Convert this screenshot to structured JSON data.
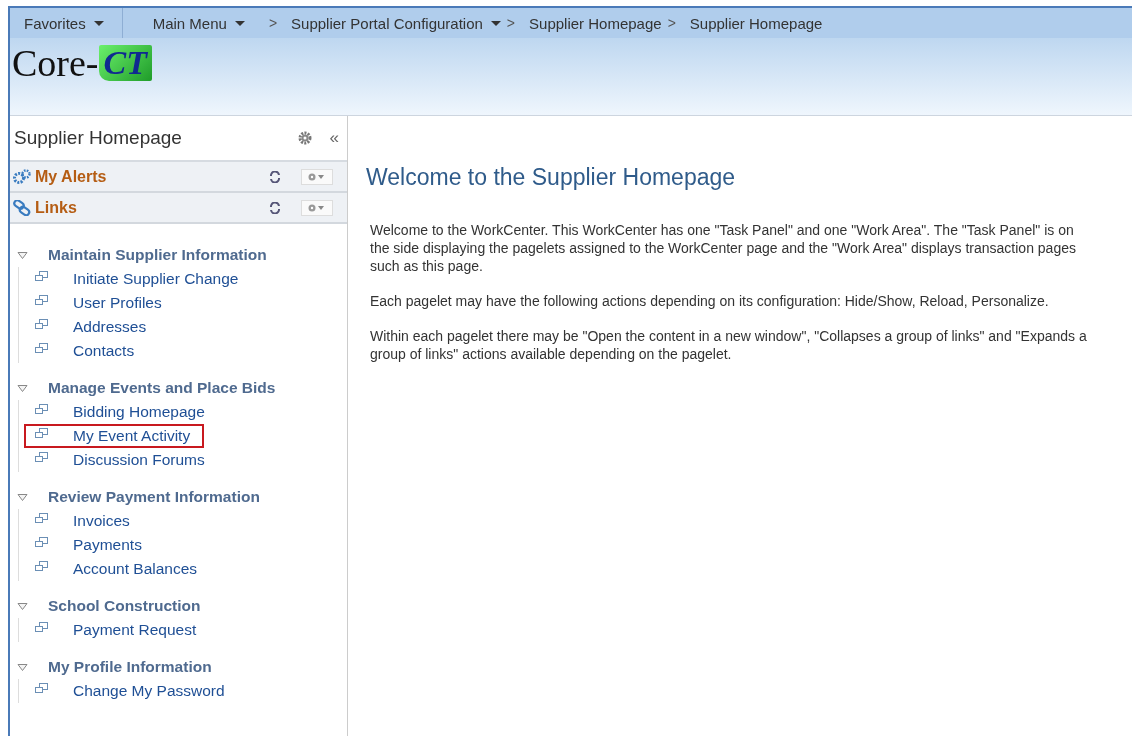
{
  "navbar": {
    "menus": [
      {
        "label": "Favorites",
        "kind": "dropdown"
      },
      {
        "label": "Main Menu",
        "kind": "dropdown"
      }
    ],
    "breadcrumbs": [
      {
        "label": "Supplier Portal Configuration",
        "kind": "dropdown"
      },
      {
        "label": "Supplier Homepage",
        "kind": "plain"
      },
      {
        "label": "Supplier Homepage",
        "kind": "plain"
      }
    ],
    "separator": ">"
  },
  "logo": {
    "text": "Core-",
    "mark": "CT"
  },
  "sidebar": {
    "title": "Supplier Homepage",
    "collapse": "«",
    "pagelets": [
      {
        "title": "My Alerts",
        "kind": "alerts"
      },
      {
        "title": "Links",
        "kind": "links"
      }
    ],
    "sections": [
      {
        "title": "Maintain Supplier Information",
        "expanded": true,
        "items": [
          {
            "label": "Initiate Supplier Change",
            "highlighted": false
          },
          {
            "label": "User Profiles",
            "highlighted": false
          },
          {
            "label": "Addresses",
            "highlighted": false
          },
          {
            "label": "Contacts",
            "highlighted": false
          }
        ]
      },
      {
        "title": "Manage Events and Place Bids",
        "expanded": true,
        "items": [
          {
            "label": "Bidding Homepage",
            "highlighted": false
          },
          {
            "label": "My Event Activity",
            "highlighted": true
          },
          {
            "label": "Discussion Forums",
            "highlighted": false
          }
        ]
      },
      {
        "title": "Review Payment Information",
        "expanded": true,
        "items": [
          {
            "label": "Invoices",
            "highlighted": false
          },
          {
            "label": "Payments",
            "highlighted": false
          },
          {
            "label": "Account Balances",
            "highlighted": false
          }
        ]
      },
      {
        "title": "School Construction",
        "expanded": true,
        "items": [
          {
            "label": "Payment Request",
            "highlighted": false
          }
        ]
      },
      {
        "title": "My Profile Information",
        "expanded": true,
        "items": [
          {
            "label": "Change My Password",
            "highlighted": false
          }
        ]
      }
    ]
  },
  "content": {
    "heading": "Welcome to the Supplier Homepage",
    "paragraphs": [
      "Welcome to the WorkCenter. This WorkCenter has one \"Task Panel\" and one \"Work Area\". The \"Task Panel\" is on the side displaying the pagelets assigned to the WorkCenter page and the \"Work Area\" displays transaction pages such as this page.",
      "Each pagelet may have the following actions depending on its configuration: Hide/Show, Reload, Personalize.",
      "Within each pagelet there may be \"Open the content in a new window\", \"Collapses a group of links\" and \"Expands a group of links\" actions available depending on the pagelet."
    ]
  }
}
